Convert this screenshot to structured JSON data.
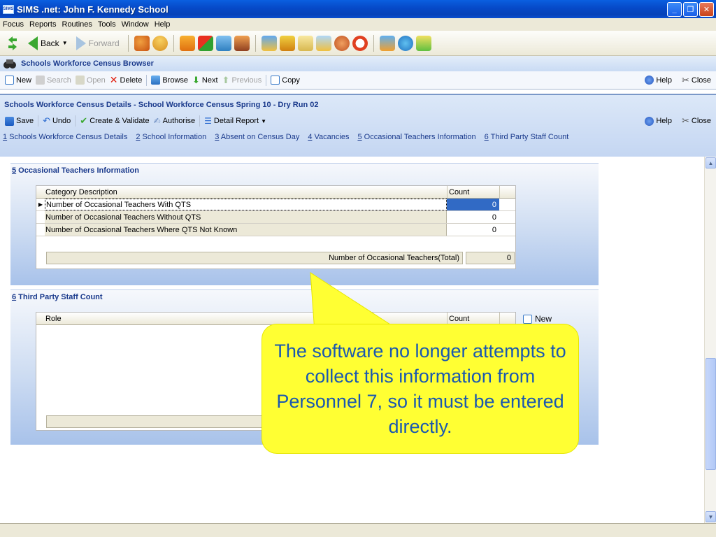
{
  "window": {
    "title": "SIMS .net: John F. Kennedy School",
    "app_icon_text": "SIMS"
  },
  "menu": [
    {
      "label": "Focus"
    },
    {
      "label": "Reports"
    },
    {
      "label": "Routines"
    },
    {
      "label": "Tools"
    },
    {
      "label": "Window"
    },
    {
      "label": "Help"
    }
  ],
  "toolbar": {
    "back": "Back",
    "forward": "Forward"
  },
  "browser": {
    "title": "Schools Workforce Census Browser",
    "buttons": {
      "new": "New",
      "search": "Search",
      "open": "Open",
      "delete": "Delete",
      "browse": "Browse",
      "next": "Next",
      "previous": "Previous",
      "copy": "Copy",
      "help": "Help",
      "close": "Close"
    }
  },
  "details": {
    "title": "Schools Workforce Census Details - School Workforce Census Spring 10 - Dry Run 02",
    "buttons": {
      "save": "Save",
      "undo": "Undo",
      "create_validate": "Create & Validate",
      "authorise": "Authorise",
      "detail_report": "Detail Report",
      "help": "Help",
      "close": "Close"
    },
    "links": [
      {
        "num": "1",
        "label": " Schools Workforce Census Details"
      },
      {
        "num": "2",
        "label": " School Information"
      },
      {
        "num": "3",
        "label": " Absent on Census Day"
      },
      {
        "num": "4",
        "label": " Vacancies"
      },
      {
        "num": "5",
        "label": " Occasional Teachers Information"
      },
      {
        "num": "6",
        "label": " Third Party Staff Count"
      }
    ]
  },
  "section5": {
    "num": "5",
    "title": " Occasional Teachers Information",
    "columns": [
      "Category Description",
      "Count"
    ],
    "rows": [
      {
        "desc": "Number of Occasional Teachers With QTS",
        "count": "0"
      },
      {
        "desc": "Number of Occasional Teachers Without QTS",
        "count": "0"
      },
      {
        "desc": "Number of Occasional Teachers Where QTS Not Known",
        "count": "0"
      }
    ],
    "total_label": "Number of Occasional Teachers(Total)",
    "total_value": "0"
  },
  "section6": {
    "num": "6",
    "title": " Third Party Staff Count",
    "columns": [
      "Role",
      "Count"
    ],
    "new_label": "New"
  },
  "callout": {
    "text": "The software no longer attempts to collect this information from Personnel 7, so it must be entered directly."
  },
  "colors": {
    "accent": "#1a3a8c",
    "selection": "#316ac5",
    "callout_bg": "#ffff33",
    "callout_text": "#1a58b0"
  }
}
